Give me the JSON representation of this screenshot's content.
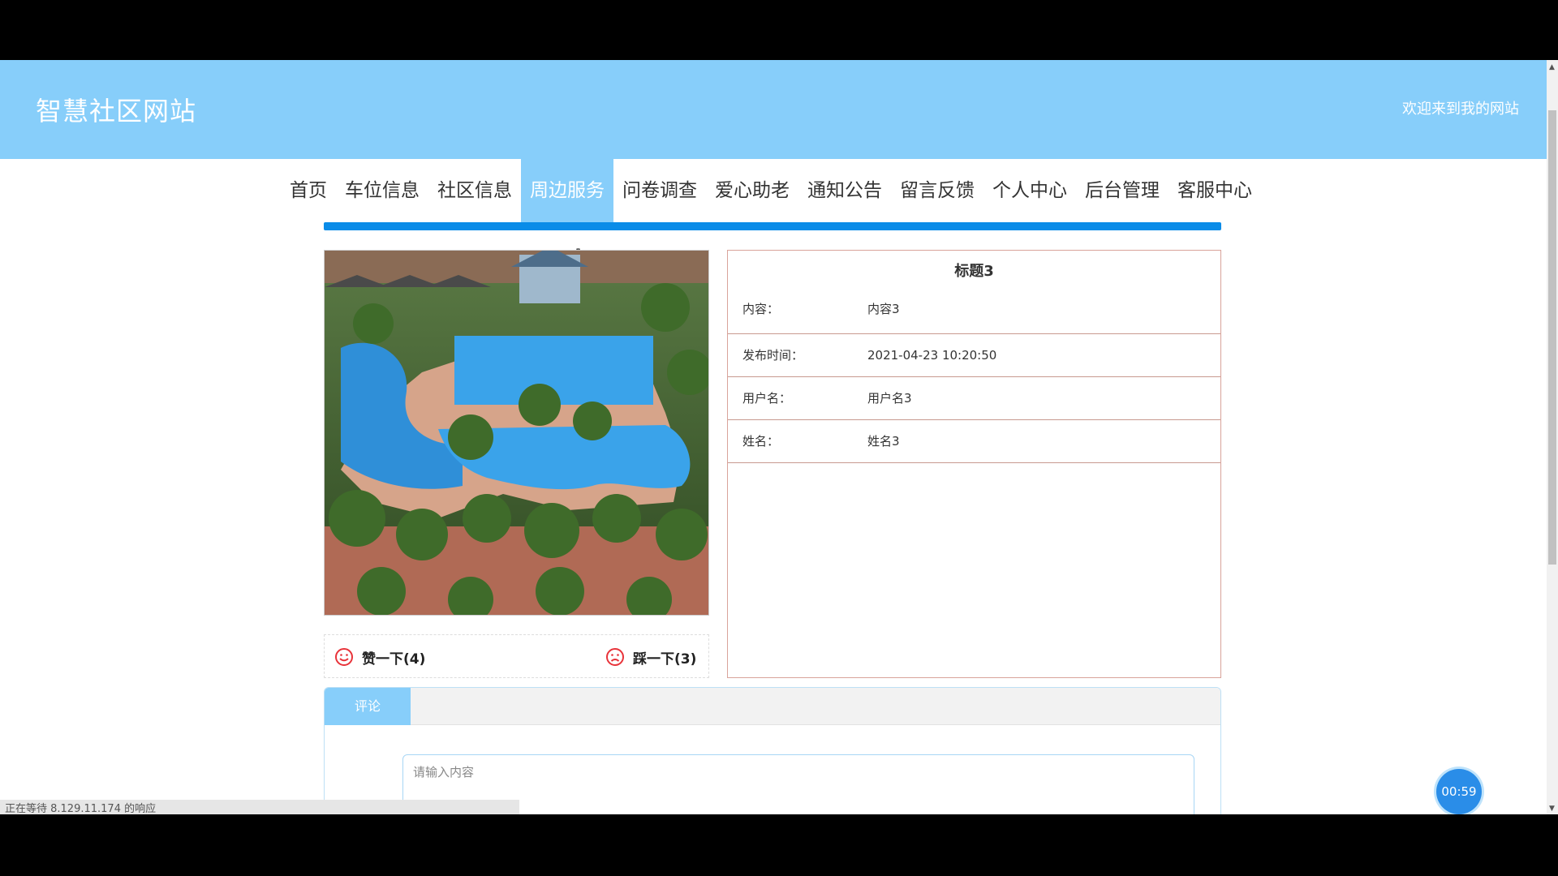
{
  "header": {
    "site_title": "智慧社区网站",
    "welcome": "欢迎来到我的网站"
  },
  "nav": {
    "items": [
      "首页",
      "车位信息",
      "社区信息",
      "周边服务",
      "问卷调查",
      "爱心助老",
      "通知公告",
      "留言反馈",
      "个人中心",
      "后台管理",
      "客服中心"
    ],
    "active": "周边服务"
  },
  "detail": {
    "title": "标题3",
    "fields": [
      {
        "label": "内容：",
        "value": "内容3"
      },
      {
        "label": "发布时间：",
        "value": "2021-04-23 10:20:50"
      },
      {
        "label": "用户名：",
        "value": "用户名3"
      },
      {
        "label": "姓名：",
        "value": "姓名3"
      }
    ]
  },
  "vote": {
    "like_label": "赞一下(4)",
    "dislike_label": "踩一下(3)"
  },
  "comment": {
    "tab_label": "评论",
    "placeholder": "请输入内容"
  },
  "status_text": "正在等待 8.129.11.174 的响应",
  "timer": "00:59",
  "colors": {
    "header_bg": "#87cefa",
    "accent_bar": "#0a8ce8",
    "icon_red": "#e8333a"
  }
}
